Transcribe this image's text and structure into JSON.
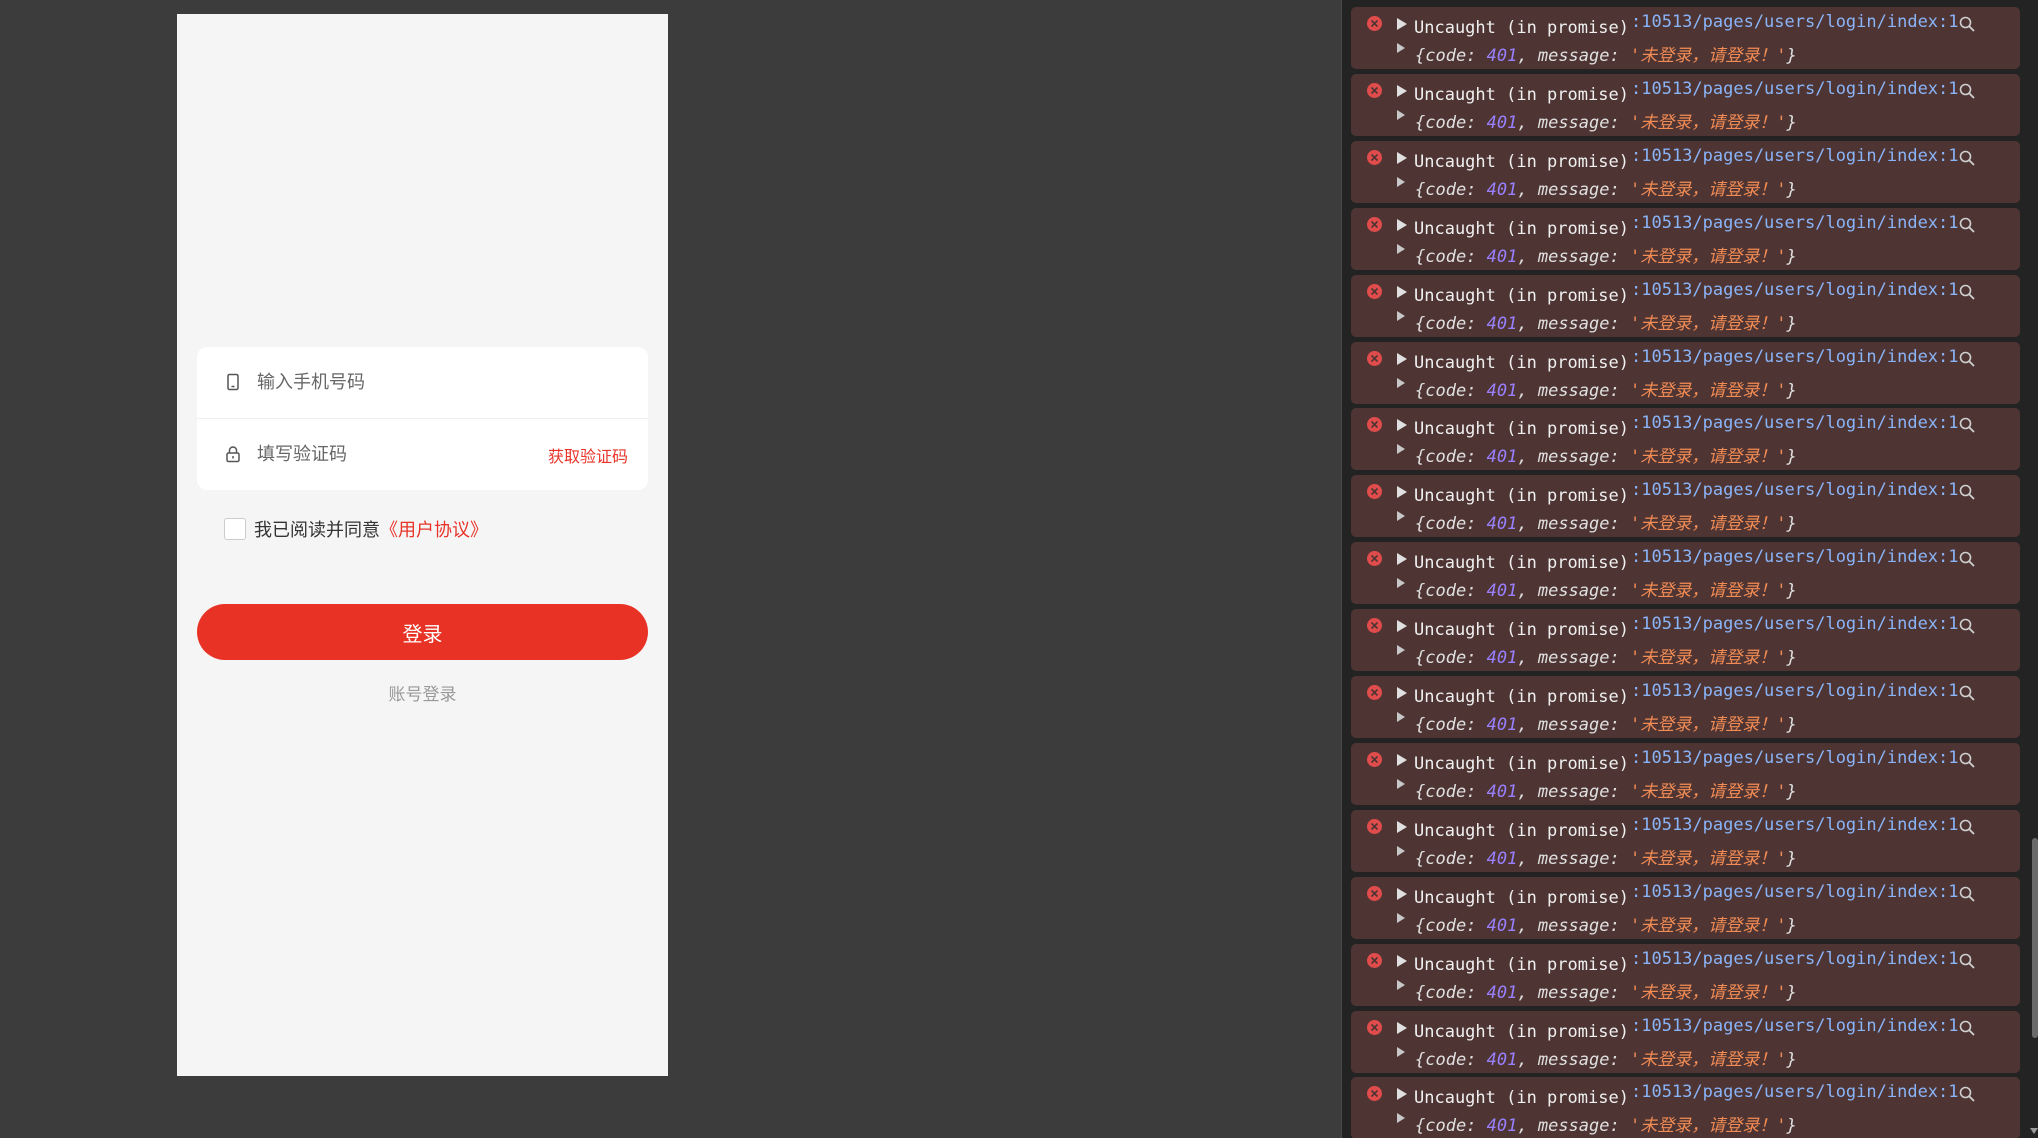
{
  "login": {
    "phone_placeholder": "输入手机号码",
    "code_placeholder": "填写验证码",
    "get_code_label": "获取验证码",
    "agree_text": "我已阅读并同意",
    "agreement_link": "《用户协议》",
    "login_button": "登录",
    "account_login": "账号登录",
    "accent_color": "#e8342a"
  },
  "console": {
    "entries": [
      {
        "message": "Uncaught (in promise)",
        "source": ":10513/pages/users/login/index:1",
        "code": "401",
        "text": "未登录，请登录！"
      },
      {
        "message": "Uncaught (in promise)",
        "source": ":10513/pages/users/login/index:1",
        "code": "401",
        "text": "未登录，请登录！"
      },
      {
        "message": "Uncaught (in promise)",
        "source": ":10513/pages/users/login/index:1",
        "code": "401",
        "text": "未登录，请登录！"
      },
      {
        "message": "Uncaught (in promise)",
        "source": ":10513/pages/users/login/index:1",
        "code": "401",
        "text": "未登录，请登录！"
      },
      {
        "message": "Uncaught (in promise)",
        "source": ":10513/pages/users/login/index:1",
        "code": "401",
        "text": "未登录，请登录！"
      },
      {
        "message": "Uncaught (in promise)",
        "source": ":10513/pages/users/login/index:1",
        "code": "401",
        "text": "未登录，请登录！"
      },
      {
        "message": "Uncaught (in promise)",
        "source": ":10513/pages/users/login/index:1",
        "code": "401",
        "text": "未登录，请登录！"
      },
      {
        "message": "Uncaught (in promise)",
        "source": ":10513/pages/users/login/index:1",
        "code": "401",
        "text": "未登录，请登录！"
      },
      {
        "message": "Uncaught (in promise)",
        "source": ":10513/pages/users/login/index:1",
        "code": "401",
        "text": "未登录，请登录！"
      },
      {
        "message": "Uncaught (in promise)",
        "source": ":10513/pages/users/login/index:1",
        "code": "401",
        "text": "未登录，请登录！"
      },
      {
        "message": "Uncaught (in promise)",
        "source": ":10513/pages/users/login/index:1",
        "code": "401",
        "text": "未登录，请登录！"
      },
      {
        "message": "Uncaught (in promise)",
        "source": ":10513/pages/users/login/index:1",
        "code": "401",
        "text": "未登录，请登录！"
      },
      {
        "message": "Uncaught (in promise)",
        "source": ":10513/pages/users/login/index:1",
        "code": "401",
        "text": "未登录，请登录！"
      },
      {
        "message": "Uncaught (in promise)",
        "source": ":10513/pages/users/login/index:1",
        "code": "401",
        "text": "未登录，请登录！"
      },
      {
        "message": "Uncaught (in promise)",
        "source": ":10513/pages/users/login/index:1",
        "code": "401",
        "text": "未登录，请登录！"
      },
      {
        "message": "Uncaught (in promise)",
        "source": ":10513/pages/users/login/index:1",
        "code": "401",
        "text": "未登录，请登录！"
      },
      {
        "message": "Uncaught (in promise)",
        "source": ":10513/pages/users/login/index:1",
        "code": "401",
        "text": "未登录，请登录！"
      }
    ],
    "error_color": "#e04c4c",
    "link_color": "#8ab4f8"
  }
}
